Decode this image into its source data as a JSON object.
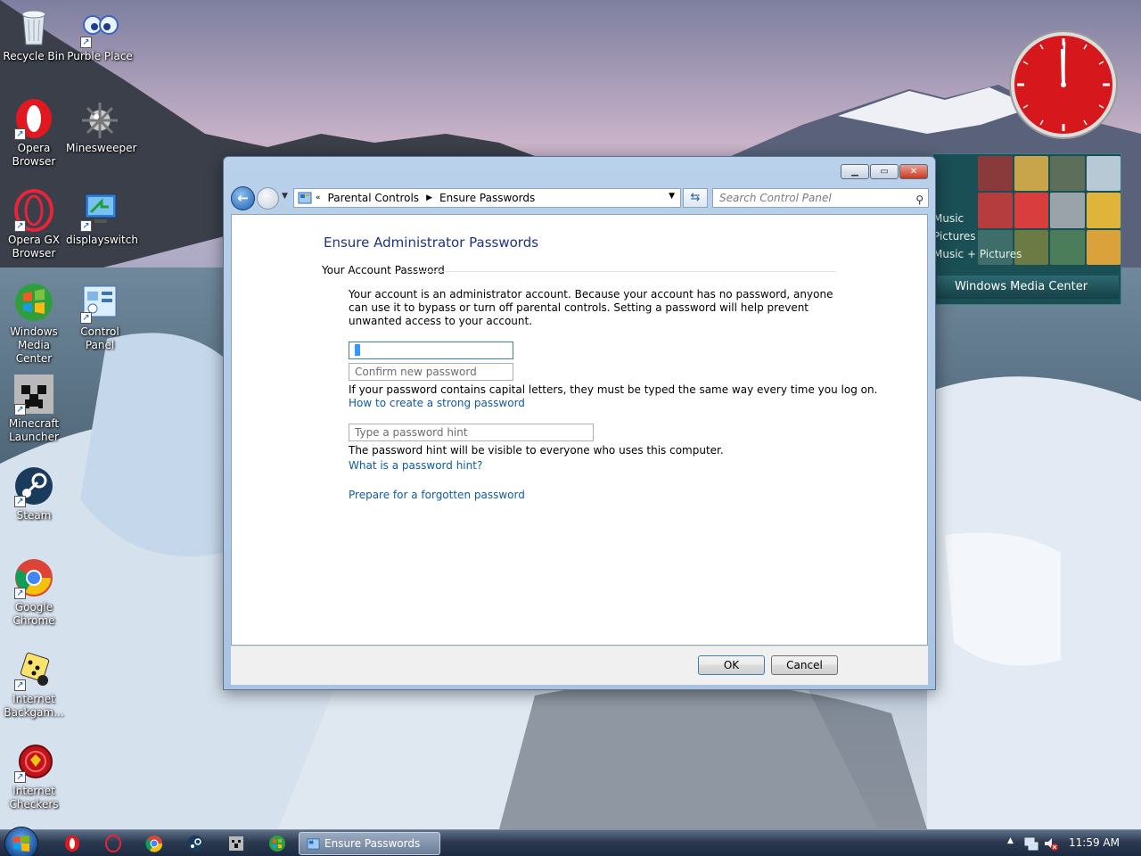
{
  "desktop": {
    "icons": [
      {
        "label": "Recycle Bin"
      },
      {
        "label": "Purble Place"
      },
      {
        "label": "Opera Browser"
      },
      {
        "label": "Minesweeper"
      },
      {
        "label": "Opera GX Browser"
      },
      {
        "label": "displayswitch"
      },
      {
        "label": "Windows Media Center"
      },
      {
        "label": "Control Panel"
      },
      {
        "label": "Minecraft Launcher"
      },
      {
        "label": "Steam"
      },
      {
        "label": "Google Chrome"
      },
      {
        "label": "Internet Backgam..."
      },
      {
        "label": "Internet Checkers"
      }
    ]
  },
  "gadgets": {
    "wmc": {
      "items": [
        "Music",
        "Pictures",
        "Music + Pictures"
      ],
      "title": "Windows Media Center"
    }
  },
  "window": {
    "nav": {
      "chevron": "«",
      "breadcrumb": [
        "Parental Controls",
        "Ensure Passwords"
      ],
      "search_placeholder": "Search Control Panel"
    },
    "page_title": "Ensure Administrator Passwords",
    "section_title": "Your Account Password",
    "description": "Your account is an administrator account. Because your account has no password, anyone can use it to bypass or turn off parental controls. Setting a password will help prevent unwanted access to your account.",
    "fields": {
      "new_password_value": "",
      "confirm_placeholder": "Confirm new password",
      "hint_placeholder": "Type a password hint"
    },
    "caps_note": "If your password contains capital letters, they must be typed the same way every time you log on.",
    "link_strong": "How to create a strong password",
    "hint_note": "The password hint will be visible to everyone who uses this computer.",
    "link_hint": "What is a password hint?",
    "link_forgotten": "Prepare for a forgotten password",
    "buttons": {
      "ok": "OK",
      "cancel": "Cancel"
    }
  },
  "taskbar": {
    "active_task": "Ensure Passwords",
    "time": "11:59 AM"
  },
  "colors": {
    "link": "#0e5ba8",
    "title": "#1e3287",
    "clock_face": "#d6171c"
  }
}
